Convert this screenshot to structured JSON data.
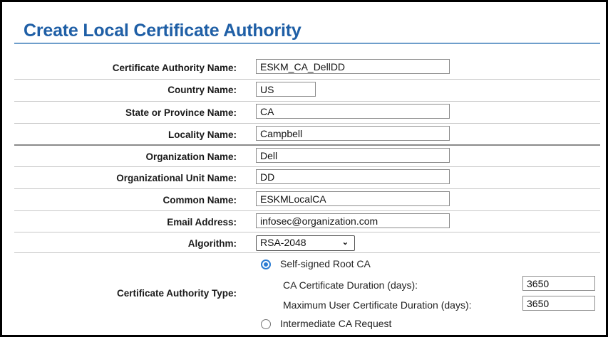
{
  "title": "Create Local Certificate Authority",
  "fields": [
    {
      "label": "Certificate Authority Name:",
      "value": "ESKM_CA_DellDD"
    },
    {
      "label": "Country Name:",
      "value": "US"
    },
    {
      "label": "State or Province Name:",
      "value": "CA"
    },
    {
      "label": "Locality Name:",
      "value": "Campbell"
    },
    {
      "label": "Organization Name:",
      "value": "Dell"
    },
    {
      "label": "Organizational Unit Name:",
      "value": "DD"
    },
    {
      "label": "Common Name:",
      "value": "ESKMLocalCA"
    },
    {
      "label": "Email Address:",
      "value": "infosec@organization.com"
    }
  ],
  "algorithm": {
    "label": "Algorithm:",
    "selected": "RSA-2048"
  },
  "ca_type": {
    "label": "Certificate Authority Type:",
    "self_signed_label": "Self-signed Root CA",
    "self_signed_selected": true,
    "ca_duration_label": "CA Certificate Duration (days):",
    "ca_duration_value": "3650",
    "max_user_duration_label": "Maximum User Certificate Duration (days):",
    "max_user_duration_value": "3650",
    "intermediate_label": "Intermediate CA Request",
    "intermediate_selected": false
  },
  "colors": {
    "title": "#1f5fa6",
    "radio_accent": "#2b7cd3"
  }
}
